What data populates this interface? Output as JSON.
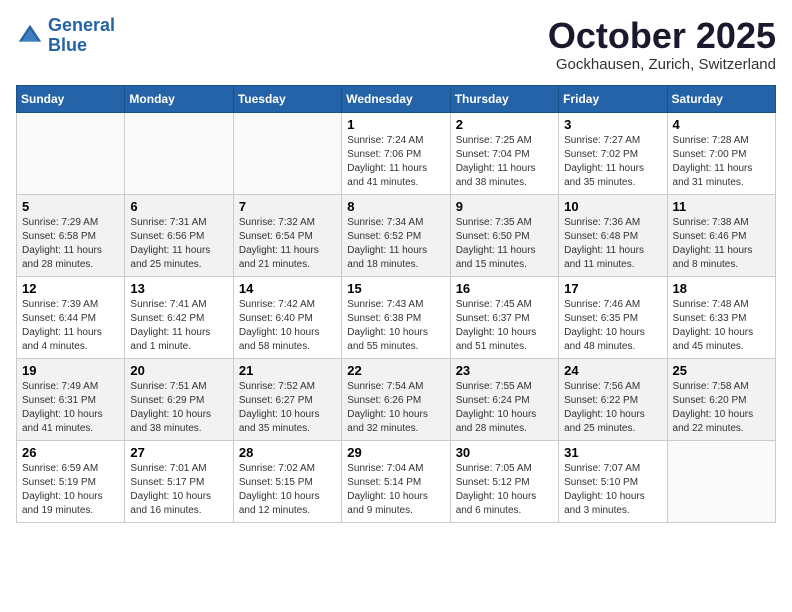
{
  "header": {
    "logo_line1": "General",
    "logo_line2": "Blue",
    "month": "October 2025",
    "location": "Gockhausen, Zurich, Switzerland"
  },
  "days_of_week": [
    "Sunday",
    "Monday",
    "Tuesday",
    "Wednesday",
    "Thursday",
    "Friday",
    "Saturday"
  ],
  "weeks": [
    [
      {
        "day": "",
        "info": ""
      },
      {
        "day": "",
        "info": ""
      },
      {
        "day": "",
        "info": ""
      },
      {
        "day": "1",
        "info": "Sunrise: 7:24 AM\nSunset: 7:06 PM\nDaylight: 11 hours\nand 41 minutes."
      },
      {
        "day": "2",
        "info": "Sunrise: 7:25 AM\nSunset: 7:04 PM\nDaylight: 11 hours\nand 38 minutes."
      },
      {
        "day": "3",
        "info": "Sunrise: 7:27 AM\nSunset: 7:02 PM\nDaylight: 11 hours\nand 35 minutes."
      },
      {
        "day": "4",
        "info": "Sunrise: 7:28 AM\nSunset: 7:00 PM\nDaylight: 11 hours\nand 31 minutes."
      }
    ],
    [
      {
        "day": "5",
        "info": "Sunrise: 7:29 AM\nSunset: 6:58 PM\nDaylight: 11 hours\nand 28 minutes."
      },
      {
        "day": "6",
        "info": "Sunrise: 7:31 AM\nSunset: 6:56 PM\nDaylight: 11 hours\nand 25 minutes."
      },
      {
        "day": "7",
        "info": "Sunrise: 7:32 AM\nSunset: 6:54 PM\nDaylight: 11 hours\nand 21 minutes."
      },
      {
        "day": "8",
        "info": "Sunrise: 7:34 AM\nSunset: 6:52 PM\nDaylight: 11 hours\nand 18 minutes."
      },
      {
        "day": "9",
        "info": "Sunrise: 7:35 AM\nSunset: 6:50 PM\nDaylight: 11 hours\nand 15 minutes."
      },
      {
        "day": "10",
        "info": "Sunrise: 7:36 AM\nSunset: 6:48 PM\nDaylight: 11 hours\nand 11 minutes."
      },
      {
        "day": "11",
        "info": "Sunrise: 7:38 AM\nSunset: 6:46 PM\nDaylight: 11 hours\nand 8 minutes."
      }
    ],
    [
      {
        "day": "12",
        "info": "Sunrise: 7:39 AM\nSunset: 6:44 PM\nDaylight: 11 hours\nand 4 minutes."
      },
      {
        "day": "13",
        "info": "Sunrise: 7:41 AM\nSunset: 6:42 PM\nDaylight: 11 hours\nand 1 minute."
      },
      {
        "day": "14",
        "info": "Sunrise: 7:42 AM\nSunset: 6:40 PM\nDaylight: 10 hours\nand 58 minutes."
      },
      {
        "day": "15",
        "info": "Sunrise: 7:43 AM\nSunset: 6:38 PM\nDaylight: 10 hours\nand 55 minutes."
      },
      {
        "day": "16",
        "info": "Sunrise: 7:45 AM\nSunset: 6:37 PM\nDaylight: 10 hours\nand 51 minutes."
      },
      {
        "day": "17",
        "info": "Sunrise: 7:46 AM\nSunset: 6:35 PM\nDaylight: 10 hours\nand 48 minutes."
      },
      {
        "day": "18",
        "info": "Sunrise: 7:48 AM\nSunset: 6:33 PM\nDaylight: 10 hours\nand 45 minutes."
      }
    ],
    [
      {
        "day": "19",
        "info": "Sunrise: 7:49 AM\nSunset: 6:31 PM\nDaylight: 10 hours\nand 41 minutes."
      },
      {
        "day": "20",
        "info": "Sunrise: 7:51 AM\nSunset: 6:29 PM\nDaylight: 10 hours\nand 38 minutes."
      },
      {
        "day": "21",
        "info": "Sunrise: 7:52 AM\nSunset: 6:27 PM\nDaylight: 10 hours\nand 35 minutes."
      },
      {
        "day": "22",
        "info": "Sunrise: 7:54 AM\nSunset: 6:26 PM\nDaylight: 10 hours\nand 32 minutes."
      },
      {
        "day": "23",
        "info": "Sunrise: 7:55 AM\nSunset: 6:24 PM\nDaylight: 10 hours\nand 28 minutes."
      },
      {
        "day": "24",
        "info": "Sunrise: 7:56 AM\nSunset: 6:22 PM\nDaylight: 10 hours\nand 25 minutes."
      },
      {
        "day": "25",
        "info": "Sunrise: 7:58 AM\nSunset: 6:20 PM\nDaylight: 10 hours\nand 22 minutes."
      }
    ],
    [
      {
        "day": "26",
        "info": "Sunrise: 6:59 AM\nSunset: 5:19 PM\nDaylight: 10 hours\nand 19 minutes."
      },
      {
        "day": "27",
        "info": "Sunrise: 7:01 AM\nSunset: 5:17 PM\nDaylight: 10 hours\nand 16 minutes."
      },
      {
        "day": "28",
        "info": "Sunrise: 7:02 AM\nSunset: 5:15 PM\nDaylight: 10 hours\nand 12 minutes."
      },
      {
        "day": "29",
        "info": "Sunrise: 7:04 AM\nSunset: 5:14 PM\nDaylight: 10 hours\nand 9 minutes."
      },
      {
        "day": "30",
        "info": "Sunrise: 7:05 AM\nSunset: 5:12 PM\nDaylight: 10 hours\nand 6 minutes."
      },
      {
        "day": "31",
        "info": "Sunrise: 7:07 AM\nSunset: 5:10 PM\nDaylight: 10 hours\nand 3 minutes."
      },
      {
        "day": "",
        "info": ""
      }
    ]
  ]
}
